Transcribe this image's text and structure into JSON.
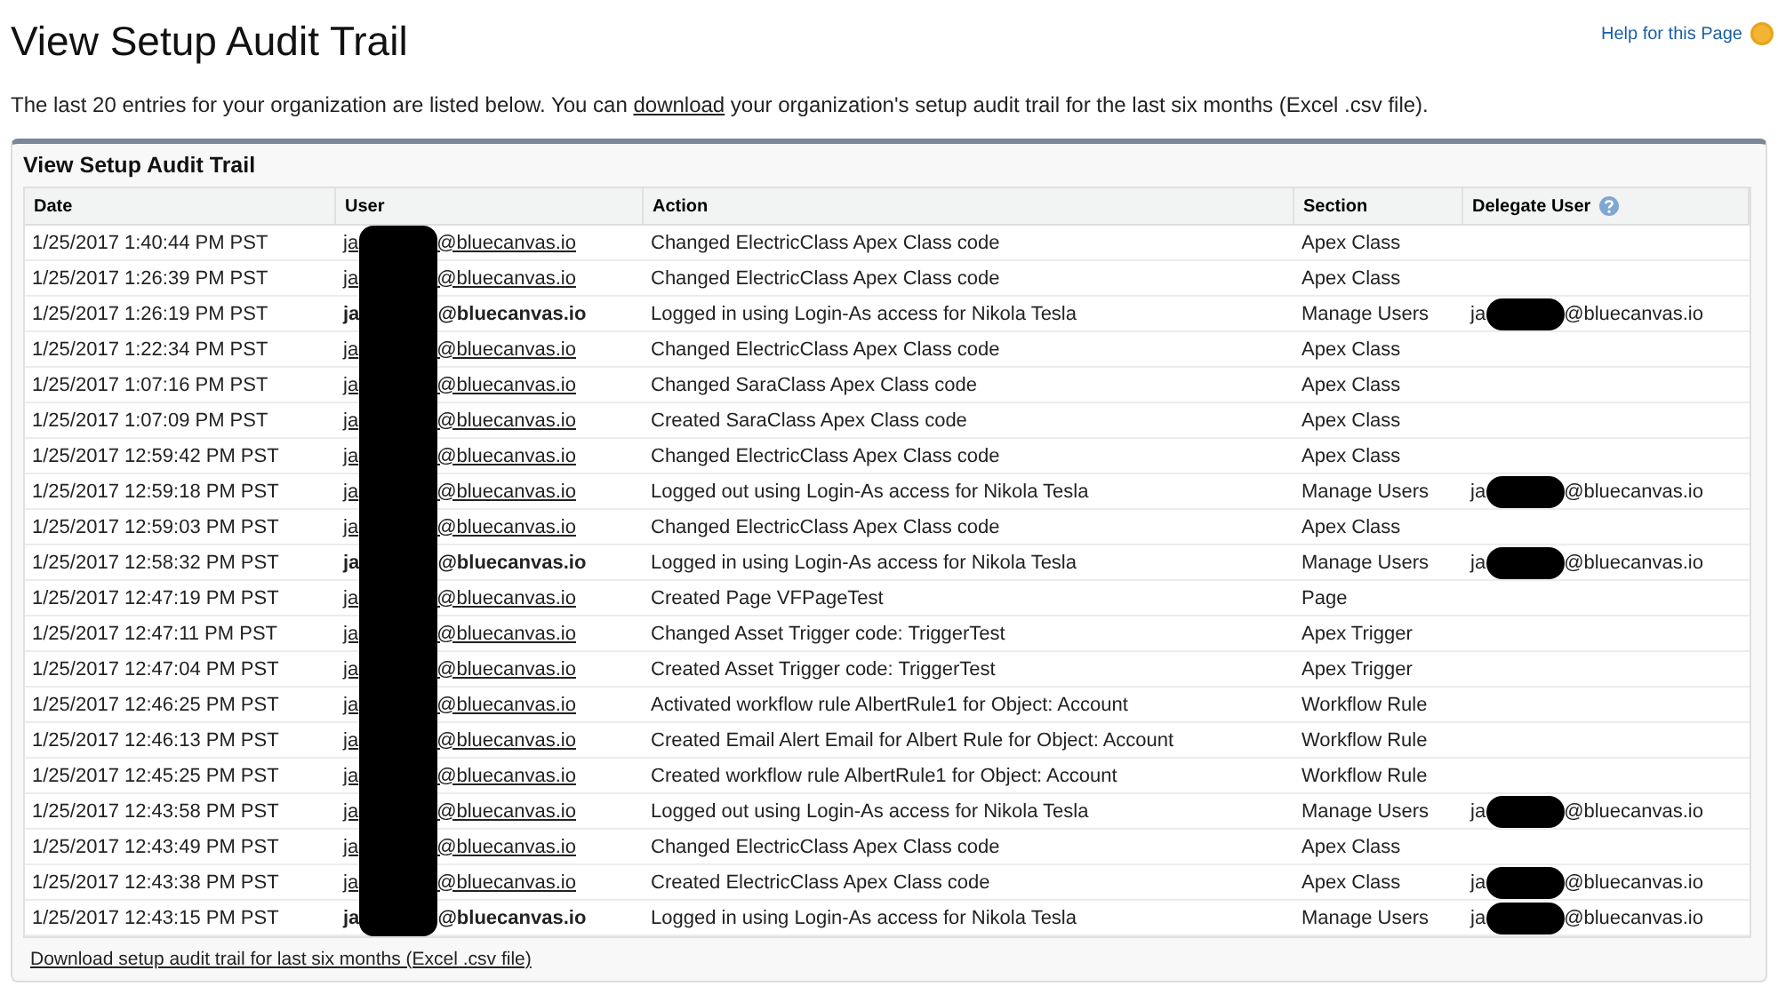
{
  "page": {
    "title": "View Setup Audit Trail",
    "help_link": "Help for this Page",
    "intro_before": "The last 20 entries for your organization are listed below. You can ",
    "intro_link": "download",
    "intro_after": " your organization's setup audit trail for the last six months (Excel .csv file)."
  },
  "panel": {
    "title": "View Setup Audit Trail",
    "footer_link": "Download setup audit trail for last six months (Excel .csv file)"
  },
  "table": {
    "columns": [
      {
        "label": "Date",
        "help": false
      },
      {
        "label": "User",
        "help": false
      },
      {
        "label": "Action",
        "help": false
      },
      {
        "label": "Section",
        "help": false
      },
      {
        "label": "Delegate User",
        "help": true
      }
    ],
    "rows": [
      {
        "date": "1/25/2017 1:40:44 PM PST",
        "user": {
          "prefix": "ja",
          "domain": "@bluecanvas.io",
          "bold": false
        },
        "action": "Changed ElectricClass Apex Class code",
        "section": "Apex Class"
      },
      {
        "date": "1/25/2017 1:26:39 PM PST",
        "user": {
          "prefix": "ja",
          "domain": "@bluecanvas.io",
          "bold": false
        },
        "action": "Changed ElectricClass Apex Class code",
        "section": "Apex Class"
      },
      {
        "date": "1/25/2017 1:26:19 PM PST",
        "user": {
          "prefix": "ja",
          "domain": "@bluecanvas.io",
          "bold": true
        },
        "action": "Logged in using Login-As access for Nikola Tesla",
        "section": "Manage Users",
        "delegate": {
          "prefix": "ja",
          "domain": "@bluecanvas.io"
        }
      },
      {
        "date": "1/25/2017 1:22:34 PM PST",
        "user": {
          "prefix": "ja",
          "domain": "@bluecanvas.io",
          "bold": false
        },
        "action": "Changed ElectricClass Apex Class code",
        "section": "Apex Class"
      },
      {
        "date": "1/25/2017 1:07:16 PM PST",
        "user": {
          "prefix": "ja",
          "domain": "@bluecanvas.io",
          "bold": false
        },
        "action": "Changed SaraClass Apex Class code",
        "section": "Apex Class"
      },
      {
        "date": "1/25/2017 1:07:09 PM PST",
        "user": {
          "prefix": "ja",
          "domain": "@bluecanvas.io",
          "bold": false
        },
        "action": "Created SaraClass Apex Class code",
        "section": "Apex Class"
      },
      {
        "date": "1/25/2017 12:59:42 PM PST",
        "user": {
          "prefix": "ja",
          "domain": "@bluecanvas.io",
          "bold": false
        },
        "action": "Changed ElectricClass Apex Class code",
        "section": "Apex Class"
      },
      {
        "date": "1/25/2017 12:59:18 PM PST",
        "user": {
          "prefix": "ja",
          "domain": "@bluecanvas.io",
          "bold": false
        },
        "action": "Logged out using Login-As access for Nikola Tesla",
        "section": "Manage Users",
        "delegate": {
          "prefix": "ja",
          "domain": "@bluecanvas.io"
        }
      },
      {
        "date": "1/25/2017 12:59:03 PM PST",
        "user": {
          "prefix": "ja",
          "domain": "@bluecanvas.io",
          "bold": false
        },
        "action": "Changed ElectricClass Apex Class code",
        "section": "Apex Class"
      },
      {
        "date": "1/25/2017 12:58:32 PM PST",
        "user": {
          "prefix": "ja",
          "domain": "@bluecanvas.io",
          "bold": true
        },
        "action": "Logged in using Login-As access for Nikola Tesla",
        "section": "Manage Users",
        "delegate": {
          "prefix": "ja",
          "domain": "@bluecanvas.io"
        }
      },
      {
        "date": "1/25/2017 12:47:19 PM PST",
        "user": {
          "prefix": "ja",
          "domain": "@bluecanvas.io",
          "bold": false
        },
        "action": "Created Page VFPageTest",
        "section": "Page"
      },
      {
        "date": "1/25/2017 12:47:11 PM PST",
        "user": {
          "prefix": "ja",
          "domain": "@bluecanvas.io",
          "bold": false
        },
        "action": "Changed Asset Trigger code: TriggerTest",
        "section": "Apex Trigger"
      },
      {
        "date": "1/25/2017 12:47:04 PM PST",
        "user": {
          "prefix": "ja",
          "domain": "@bluecanvas.io",
          "bold": false
        },
        "action": "Created Asset Trigger code: TriggerTest",
        "section": "Apex Trigger"
      },
      {
        "date": "1/25/2017 12:46:25 PM PST",
        "user": {
          "prefix": "ja",
          "domain": "@bluecanvas.io",
          "bold": false
        },
        "action": "Activated workflow rule AlbertRule1 for Object: Account",
        "section": "Workflow Rule"
      },
      {
        "date": "1/25/2017 12:46:13 PM PST",
        "user": {
          "prefix": "ja",
          "domain": "@bluecanvas.io",
          "bold": false
        },
        "action": "Created Email Alert Email for Albert Rule for Object: Account",
        "section": "Workflow Rule"
      },
      {
        "date": "1/25/2017 12:45:25 PM PST",
        "user": {
          "prefix": "ja",
          "domain": "@bluecanvas.io",
          "bold": false
        },
        "action": "Created workflow rule AlbertRule1 for Object: Account",
        "section": "Workflow Rule"
      },
      {
        "date": "1/25/2017 12:43:58 PM PST",
        "user": {
          "prefix": "ja",
          "domain": "@bluecanvas.io",
          "bold": false
        },
        "action": "Logged out using Login-As access for Nikola Tesla",
        "section": "Manage Users",
        "delegate": {
          "prefix": "ja",
          "domain": "@bluecanvas.io"
        }
      },
      {
        "date": "1/25/2017 12:43:49 PM PST",
        "user": {
          "prefix": "ja",
          "domain": "@bluecanvas.io",
          "bold": false
        },
        "action": "Changed ElectricClass Apex Class code",
        "section": "Apex Class"
      },
      {
        "date": "1/25/2017 12:43:38 PM PST",
        "user": {
          "prefix": "ja",
          "domain": "@bluecanvas.io",
          "bold": false
        },
        "action": "Created ElectricClass Apex Class code",
        "section": "Apex Class",
        "delegate": {
          "prefix": "ja",
          "domain": "@bluecanvas.io"
        }
      },
      {
        "date": "1/25/2017 12:43:15 PM PST",
        "user": {
          "prefix": "ja",
          "domain": "@bluecanvas.io",
          "bold": true
        },
        "action": "Logged in using Login-As access for Nikola Tesla",
        "section": "Manage Users",
        "delegate": {
          "prefix": "ja",
          "domain": "@bluecanvas.io"
        }
      }
    ]
  }
}
